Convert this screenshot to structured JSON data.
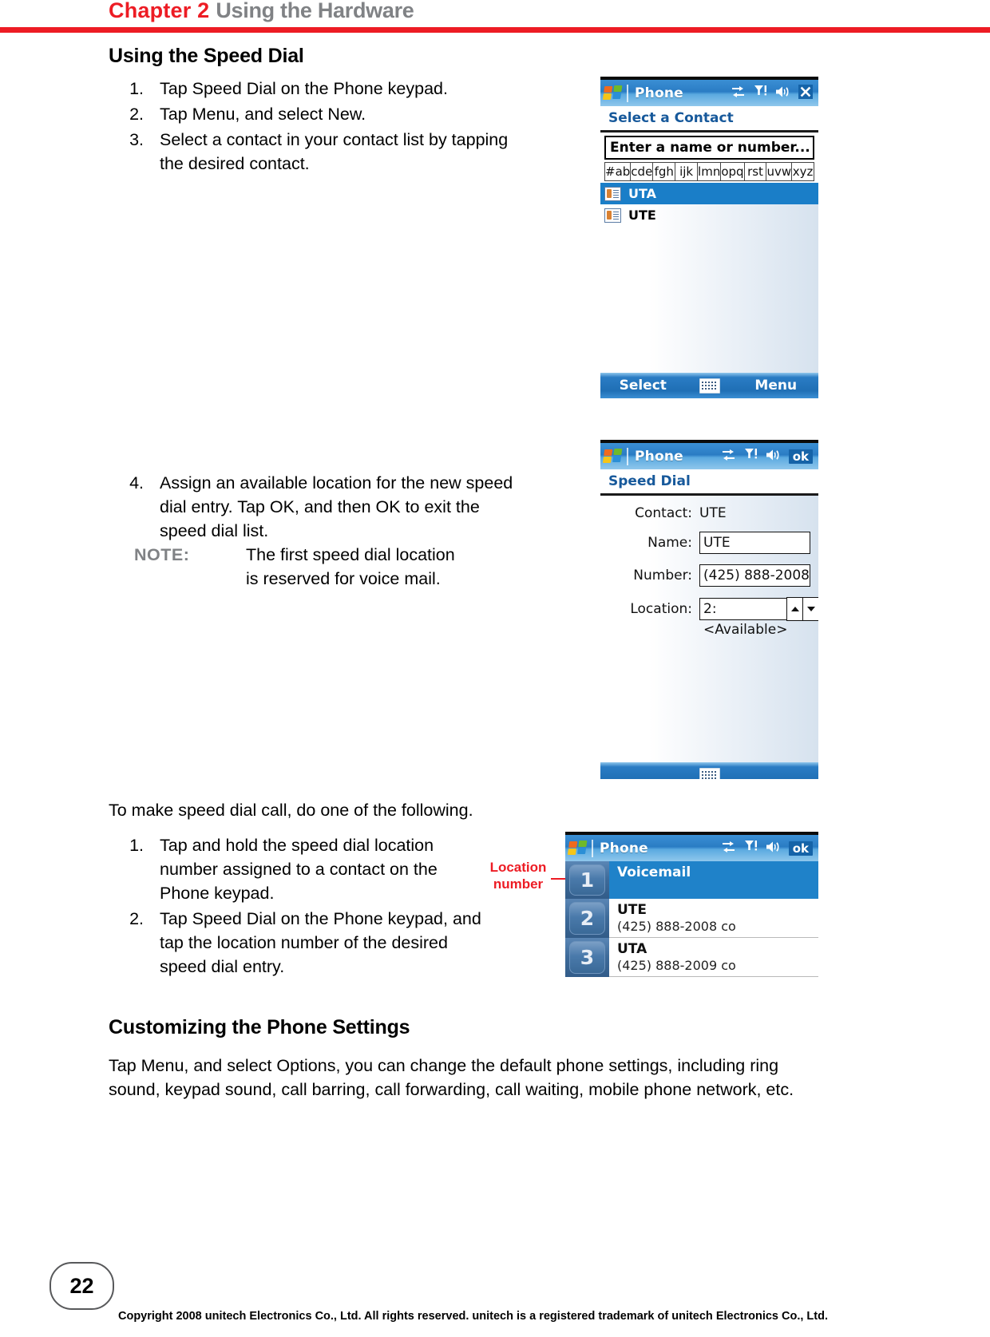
{
  "header": {
    "chapter_label": "Chapter 2",
    "chapter_title": "Using the Hardware",
    "rule_color": "#ED1C24",
    "title_color": "#808285"
  },
  "sections": {
    "speed_dial": {
      "heading": "Using the Speed Dial",
      "steps": [
        {
          "num": "1.",
          "text": "Tap Speed Dial on the Phone keypad."
        },
        {
          "num": "2.",
          "text": "Tap Menu, and select New."
        },
        {
          "num": "3.",
          "text": "Select a contact in your contact list by tapping the desired contact."
        },
        {
          "num": "4.",
          "text": "Assign an available location for the new speed dial entry. Tap OK, and then OK to exit the speed dial list."
        }
      ],
      "note": {
        "label": "NOTE:",
        "text": "The first speed dial location is reserved for voice mail."
      }
    },
    "make_call": {
      "intro": "To make speed dial call, do one of the following.",
      "steps": [
        {
          "num": "1.",
          "text": "Tap and hold the speed dial location number assigned to a contact on the Phone keypad."
        },
        {
          "num": "2.",
          "text": "Tap Speed Dial on the Phone keypad, and tap the location number of the desired speed dial entry."
        }
      ]
    },
    "customizing": {
      "heading": "Customizing the Phone Settings",
      "paragraph": "Tap Menu, and select Options, you can change the default phone settings, including ring sound, keypad sound, call barring, call forwarding, call waiting, mobile phone network, etc."
    }
  },
  "callout": {
    "line1": "Location",
    "line2": "number",
    "color": "#ED1C24"
  },
  "screenshots": {
    "select_contact": {
      "title": "Phone",
      "tray_icons": [
        "connectivity-icon",
        "signal-icon",
        "volume-icon",
        "close-icon"
      ],
      "close_label": "",
      "page_title": "Select a Contact",
      "search_placeholder": "Enter a name or number...",
      "alpha_keys": [
        "#ab",
        "cde",
        "fgh",
        "ijk",
        "lmn",
        "opq",
        "rst",
        "uvw",
        "xyz"
      ],
      "contacts": [
        {
          "name": "UTA",
          "selected": true
        },
        {
          "name": "UTE",
          "selected": false
        }
      ],
      "softkey_left": "Select",
      "softkey_mid": "keyboard-icon",
      "softkey_right": "Menu"
    },
    "speed_dial_form": {
      "title": "Phone",
      "tray_icons": [
        "connectivity-icon",
        "signal-icon",
        "volume-icon",
        "ok-button"
      ],
      "ok_label": "ok",
      "page_title": "Speed Dial",
      "fields": [
        {
          "label": "Contact:",
          "value": "UTE",
          "type": "text"
        },
        {
          "label": "Name:",
          "value": "UTE",
          "type": "input"
        },
        {
          "label": "Number:",
          "value": "(425) 888-2008",
          "type": "input"
        },
        {
          "label": "Location:",
          "value": "2:<Available>",
          "type": "spinner"
        }
      ],
      "softkey_mid": "keyboard-icon"
    },
    "speed_dial_list": {
      "title": "Phone",
      "tray_icons": [
        "connectivity-icon",
        "signal-icon",
        "volume-icon",
        "ok-button"
      ],
      "ok_label": "ok",
      "entries": [
        {
          "num": "1",
          "name": "Voicemail",
          "sub": "",
          "selected": true
        },
        {
          "num": "2",
          "name": "UTE",
          "sub": "(425) 888-2008 co",
          "selected": false
        },
        {
          "num": "3",
          "name": "UTA",
          "sub": "(425) 888-2009 co",
          "selected": false
        }
      ]
    }
  },
  "footer": {
    "page_number": "22",
    "copyright": "Copyright 2008 unitech Electronics Co., Ltd. All rights reserved. unitech is a registered trademark of unitech Electronics Co., Ltd."
  }
}
